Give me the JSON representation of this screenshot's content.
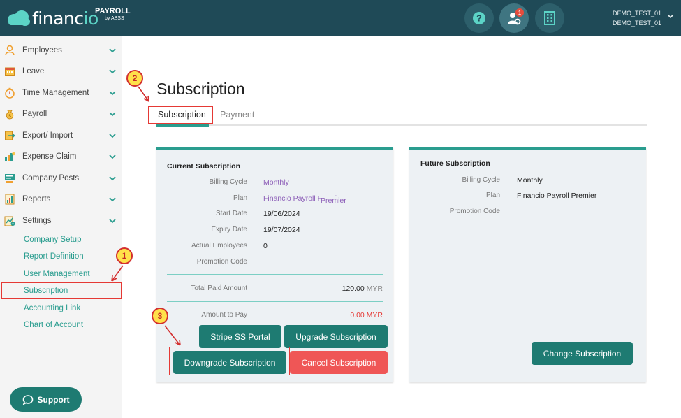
{
  "header": {
    "logo_text": "financ",
    "logo_text_accent": "io",
    "product": "PAYROLL",
    "product_sub": "by ABSS",
    "notification_count": "1",
    "user_line1": "DEMO_TEST_01",
    "user_line2": "DEMO_TEST_01",
    "icons": [
      "help-icon",
      "user-settings-icon",
      "company-building-icon"
    ]
  },
  "sidebar": {
    "items": [
      {
        "label": "Employees",
        "icon": "user-icon"
      },
      {
        "label": "Leave",
        "icon": "calendar-icon"
      },
      {
        "label": "Time Management",
        "icon": "stopwatch-icon"
      },
      {
        "label": "Payroll",
        "icon": "money-bag-icon"
      },
      {
        "label": "Export/ Import",
        "icon": "export-import-icon"
      },
      {
        "label": "Expense Claim",
        "icon": "expense-icon"
      },
      {
        "label": "Company Posts",
        "icon": "posts-icon"
      },
      {
        "label": "Reports",
        "icon": "report-icon"
      },
      {
        "label": "Settings",
        "icon": "settings-icon"
      }
    ],
    "settings_sub": [
      "Company Setup",
      "Report Definition",
      "User Management",
      "Subscription",
      "Accounting Link",
      "Chart of Account"
    ],
    "support_label": "Support"
  },
  "page": {
    "title": "Subscription",
    "tabs": [
      "Subscription",
      "Payment"
    ]
  },
  "current": {
    "title": "Current Subscription",
    "labels": [
      "Billing Cycle",
      "Plan",
      "Start Date",
      "Expiry Date",
      "Actual Employees",
      "Promotion Code"
    ],
    "billing_cycle": "Monthly",
    "plan": "Financio Payroll Premier",
    "plan_overlay": "Premier",
    "start_date": "19/06/2024",
    "expiry_date": "19/07/2024",
    "actual_employees": "0",
    "promotion_code": "",
    "total_paid_label": "Total Paid Amount",
    "total_paid_value": "120.00",
    "total_paid_unit": "MYR",
    "amount_to_pay_label": "Amount to Pay",
    "amount_to_pay_value": "0.00 MYR",
    "buttons": {
      "stripe": "Stripe SS Portal",
      "upgrade": "Upgrade Subscription",
      "downgrade": "Downgrade Subscription",
      "cancel": "Cancel Subscription"
    }
  },
  "future": {
    "title": "Future Subscription",
    "labels": [
      "Billing Cycle",
      "Plan",
      "Promotion Code"
    ],
    "billing_cycle": "Monthly",
    "plan": "Financio Payroll Premier",
    "change_button": "Change Subscription"
  },
  "annotations": [
    "1",
    "2",
    "3"
  ],
  "colors": {
    "topbar": "#1f4a57",
    "teal": "#2a9d8f",
    "button_teal": "#1e7b72",
    "button_red": "#ef5656",
    "amount_red": "#e53935",
    "marker_fill": "#ffe14a",
    "marker_border": "#d32f2f"
  }
}
